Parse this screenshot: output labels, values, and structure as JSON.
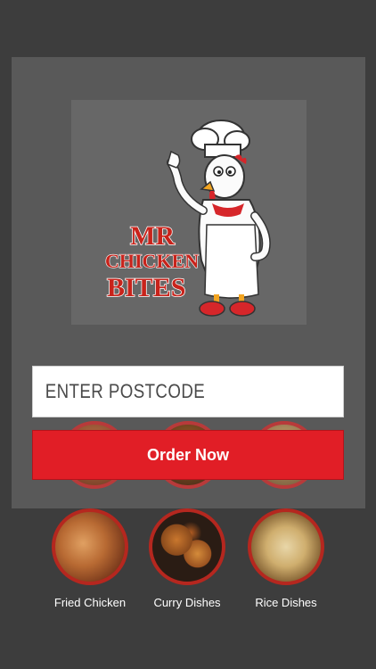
{
  "logo": {
    "line1": "MR",
    "line2": "CHICKEN",
    "line3": "BITES"
  },
  "postcode": {
    "placeholder": "ENTER POSTCODE",
    "value": ""
  },
  "order_button": {
    "label": "Order Now"
  },
  "categories": [
    {
      "label": "Fried Chicken",
      "icon": "fried-chicken-image"
    },
    {
      "label": "Curry Dishes",
      "icon": "curry-dishes-image"
    },
    {
      "label": "Rice Dishes",
      "icon": "rice-dishes-image"
    }
  ],
  "colors": {
    "background": "#3d3d3d",
    "panel": "#595959",
    "accent": "#e11e26",
    "logo_text": "#c8231b"
  }
}
